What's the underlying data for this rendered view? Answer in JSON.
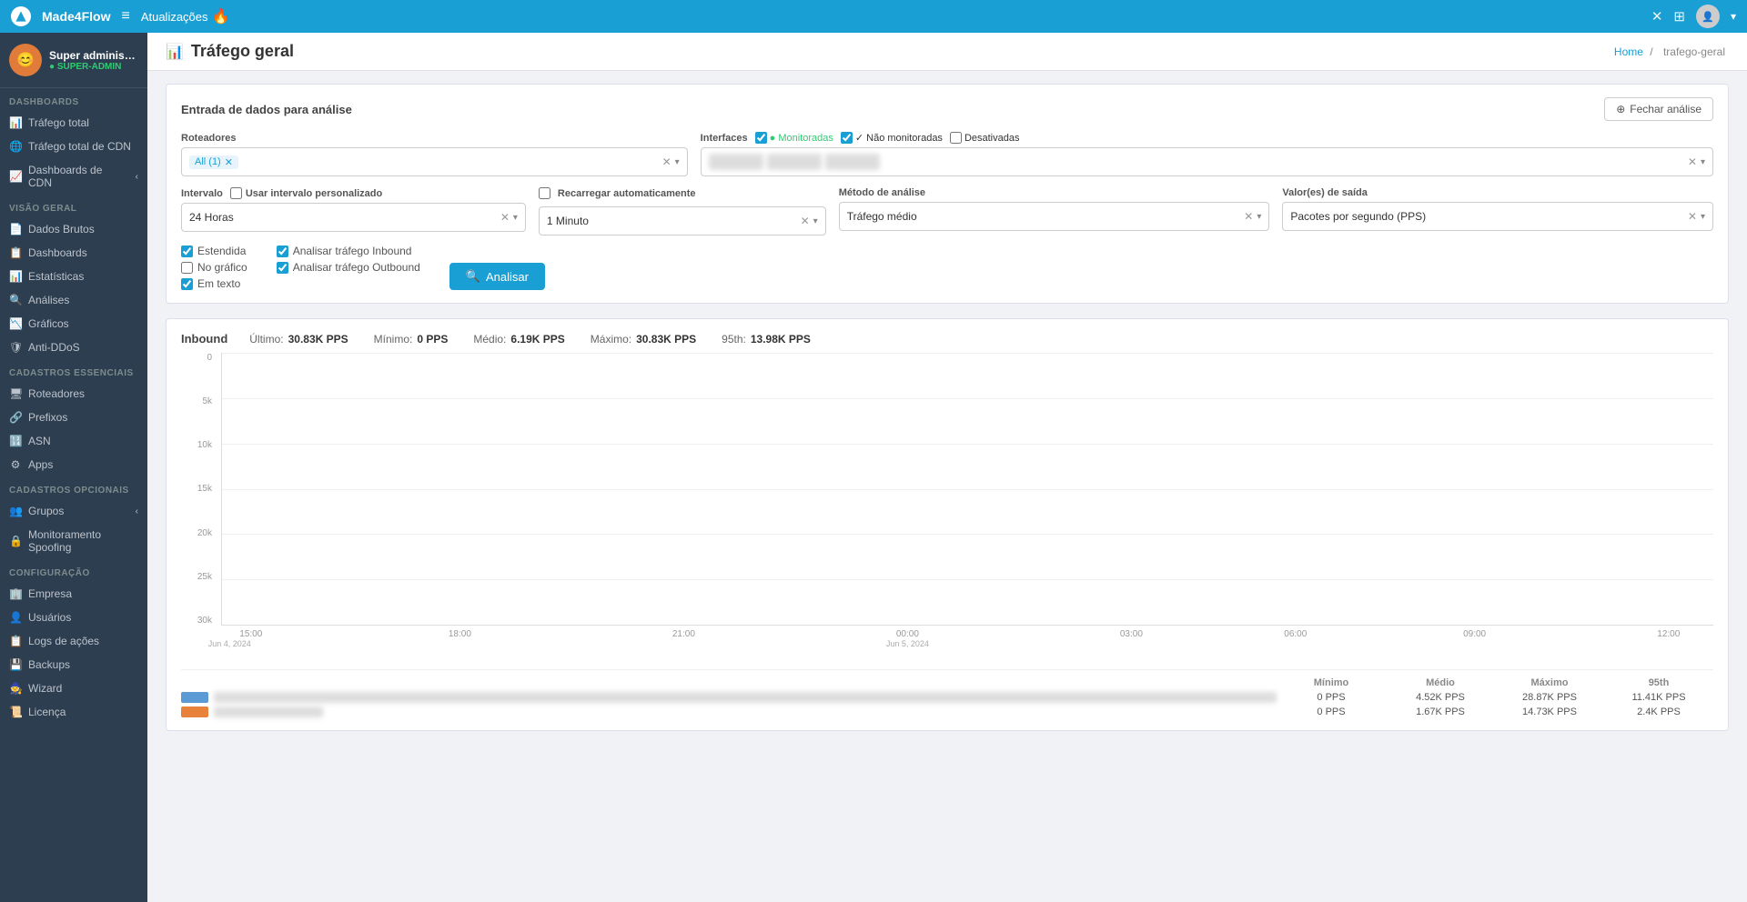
{
  "app": {
    "name": "Made4Flow",
    "logo_letter": "4"
  },
  "topnav": {
    "hamburger": "≡",
    "updates_label": "Atualizações",
    "close_icon": "✕",
    "grid_icon": "⊞",
    "user_label": "User"
  },
  "breadcrumb": {
    "home": "Home",
    "separator": "/",
    "current": "trafego-geral"
  },
  "page": {
    "title": "Tráfego geral",
    "icon": "📊"
  },
  "sidebar": {
    "user": {
      "name": "Super administrador",
      "role": "● SUPER-ADMIN"
    },
    "sections": [
      {
        "label": "Dashboards",
        "items": [
          {
            "icon": "📊",
            "label": "Tráfego total"
          },
          {
            "icon": "🌐",
            "label": "Tráfego total de CDN"
          },
          {
            "icon": "📈",
            "label": "Dashboards de CDN",
            "has_arrow": true
          }
        ]
      },
      {
        "label": "Visão geral",
        "items": [
          {
            "icon": "📄",
            "label": "Dados Brutos"
          },
          {
            "icon": "📋",
            "label": "Dashboards"
          },
          {
            "icon": "📊",
            "label": "Estatísticas"
          },
          {
            "icon": "🔍",
            "label": "Análises"
          },
          {
            "icon": "📉",
            "label": "Gráficos"
          },
          {
            "icon": "🛡",
            "label": "Anti-DDoS"
          }
        ]
      },
      {
        "label": "Cadastros essenciais",
        "items": [
          {
            "icon": "🖥",
            "label": "Roteadores"
          },
          {
            "icon": "🔗",
            "label": "Prefixos"
          },
          {
            "icon": "🔢",
            "label": "ASN"
          },
          {
            "icon": "⚙",
            "label": "Apps"
          }
        ]
      },
      {
        "label": "Cadastros opcionais",
        "items": [
          {
            "icon": "👥",
            "label": "Grupos",
            "has_arrow": true
          },
          {
            "icon": "🔒",
            "label": "Monitoramento Spoofing"
          }
        ]
      },
      {
        "label": "Configuração",
        "items": [
          {
            "icon": "🏢",
            "label": "Empresa"
          },
          {
            "icon": "👤",
            "label": "Usuários"
          },
          {
            "icon": "📋",
            "label": "Logs de ações"
          },
          {
            "icon": "💾",
            "label": "Backups"
          },
          {
            "icon": "🧙",
            "label": "Wizard"
          },
          {
            "icon": "📜",
            "label": "Licença"
          }
        ]
      }
    ]
  },
  "analysis_panel": {
    "title": "Entrada de dados para análise",
    "close_btn": "Fechar análise",
    "routers_label": "Roteadores",
    "routers_value": "All (1)",
    "interfaces_label": "Interfaces",
    "interfaces_checkboxes": [
      {
        "label": "Monitoradas",
        "checked": true,
        "color": "#2ecc71"
      },
      {
        "label": "Não monitoradas",
        "checked": true,
        "color": "#1a9fd4"
      },
      {
        "label": "Desativadas",
        "checked": false,
        "color": "#ccc"
      }
    ],
    "interval_label": "Intervalo",
    "interval_custom_label": "Usar intervalo personalizado",
    "interval_value": "24 Horas",
    "reload_auto_label": "Recarregar automaticamente",
    "interval_count_value": "1 Minuto",
    "analysis_method_label": "Método de análise",
    "analysis_method_value": "Tráfego médio",
    "output_values_label": "Valor(es) de saída",
    "output_values_value": "Pacotes por segundo (PPS)",
    "checkboxes": [
      {
        "label": "Estendida",
        "checked": true
      },
      {
        "label": "No gráfico",
        "checked": false
      },
      {
        "label": "Em texto",
        "checked": true
      }
    ],
    "traffic_checkboxes": [
      {
        "label": "Analisar tráfego Inbound",
        "checked": true
      },
      {
        "label": "Analisar tráfego Outbound",
        "checked": true
      }
    ],
    "analyze_btn": "Analisar"
  },
  "chart": {
    "inbound_label": "Inbound",
    "stats": [
      {
        "label": "Último:",
        "value": "30.83K PPS"
      },
      {
        "label": "Mínimo:",
        "value": "0 PPS"
      },
      {
        "label": "Médio:",
        "value": "6.19K PPS"
      },
      {
        "label": "Máximo:",
        "value": "30.83K PPS"
      },
      {
        "label": "95th:",
        "value": "13.98K PPS"
      }
    ],
    "y_labels": [
      "30k",
      "25k",
      "20k",
      "15k",
      "10k",
      "5k",
      "0"
    ],
    "x_labels": [
      {
        "time": "15:00",
        "date": "Jun 4, 2024",
        "pos_pct": 2
      },
      {
        "time": "18:00",
        "date": "",
        "pos_pct": 16
      },
      {
        "time": "21:00",
        "date": "",
        "pos_pct": 31
      },
      {
        "time": "00:00",
        "date": "Jun 5, 2024",
        "pos_pct": 46
      },
      {
        "time": "03:00",
        "date": "",
        "pos_pct": 61
      },
      {
        "time": "06:00",
        "date": "",
        "pos_pct": 72
      },
      {
        "time": "09:00",
        "date": "",
        "pos_pct": 84
      },
      {
        "time": "12:00",
        "date": "",
        "pos_pct": 97
      }
    ],
    "legend": [
      {
        "color": "#5b9bd5",
        "min": "0 PPS",
        "avg": "4.52K PPS",
        "max": "28.87K PPS",
        "p95": "11.41K PPS"
      },
      {
        "color": "#e8823a",
        "min": "0 PPS",
        "avg": "1.67K PPS",
        "max": "14.73K PPS",
        "p95": "2.4K PPS"
      }
    ],
    "legend_headers": [
      "Mínimo",
      "Médio",
      "Máximo",
      "95th"
    ]
  }
}
